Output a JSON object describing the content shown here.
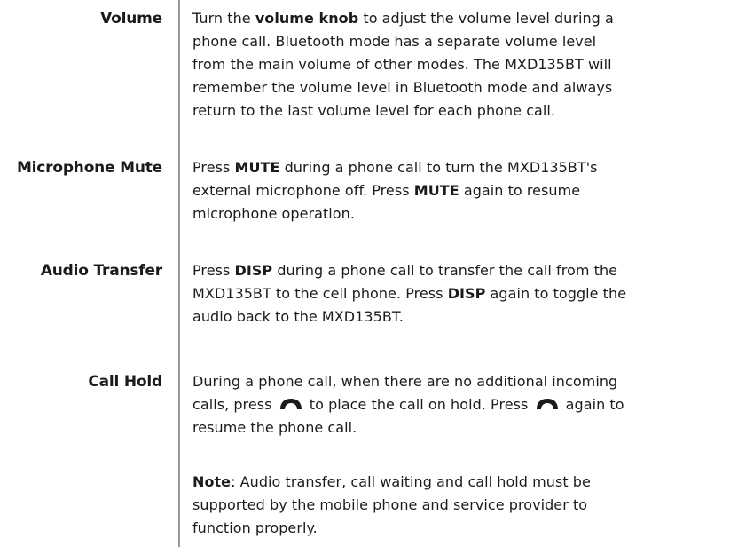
{
  "entries": [
    {
      "term": "Volume",
      "desc": {
        "l1a": "Turn the ",
        "l1b": "volume knob",
        "l1c": " to adjust the volume level during a",
        "l2": "phone call. Bluetooth mode has a separate volume level",
        "l3": "from the main volume of other modes. The MXD135BT will",
        "l4": "remember the volume level in Bluetooth mode and always",
        "l5": "return to the last volume level for each phone call."
      }
    },
    {
      "term": "Microphone Mute",
      "desc": {
        "l1a": "Press ",
        "l1b": "MUTE",
        "l1c": " during a phone call to turn the MXD135BT's",
        "l2a": "external microphone off. Press ",
        "l2b": "MUTE",
        "l2c": " again to resume",
        "l3": "microphone operation."
      }
    },
    {
      "term": "Audio Transfer",
      "desc": {
        "l1a": "Press ",
        "l1b": "DISP",
        "l1c": " during a phone call to transfer the call from the",
        "l2a": "MXD135BT to the cell phone. Press ",
        "l2b": "DISP",
        "l2c": " again to toggle the",
        "l3": "audio back to the MXD135BT."
      }
    },
    {
      "term": "Call Hold",
      "desc": {
        "l1": "During a phone call, when there are no additional incoming",
        "l2a": "calls, press ",
        "l2b": " to place the call on hold. Press ",
        "l2c": " again to",
        "l3": "resume the phone call."
      },
      "icon": "phone-handset-icon"
    }
  ],
  "note": {
    "label": "Note",
    "l1": ": Audio transfer, call waiting and call hold must be",
    "l2": "supported by the mobile phone and service provider to",
    "l3": "function properly."
  },
  "colors": {
    "text": "#1b1b1b",
    "divider": "#9a9a9a",
    "background": "#ffffff"
  }
}
